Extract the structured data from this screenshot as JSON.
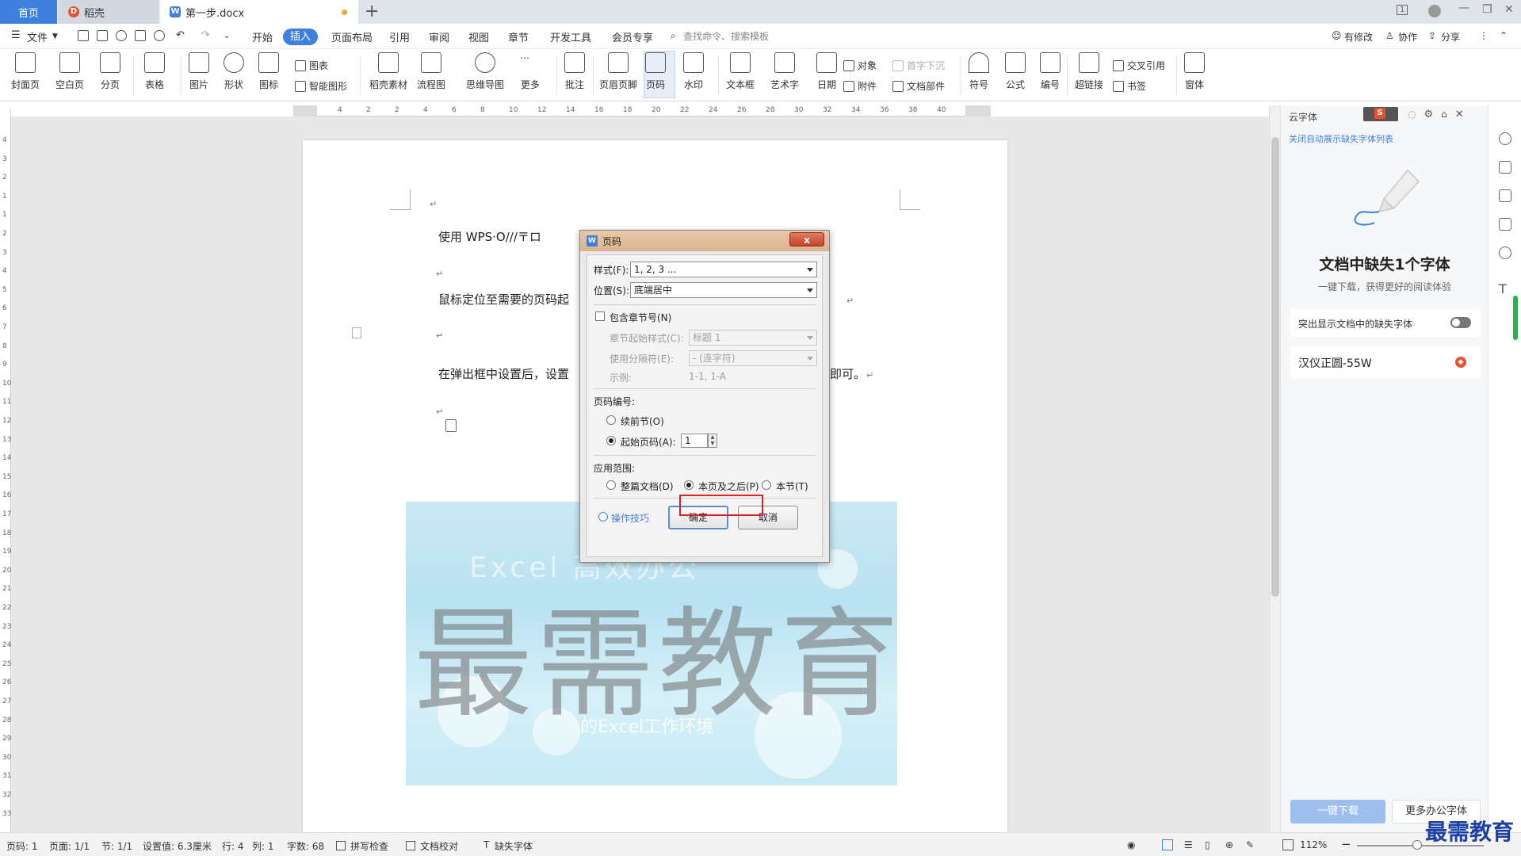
{
  "tabs": {
    "home": "首页",
    "daoke": "稻壳",
    "doc": "第一步.docx",
    "badge": "1"
  },
  "menu": {
    "file": "文件",
    "start": "开始",
    "insert": "插入",
    "layout": "页面布局",
    "reference": "引用",
    "review": "审阅",
    "view": "视图",
    "chapter": "章节",
    "devtools": "开发工具",
    "member": "会员专享",
    "search_placeholder": "查找命令、搜索模板",
    "modified": "有修改",
    "collab": "协作",
    "share": "分享"
  },
  "ribbon": {
    "cover": "封面页",
    "blank": "空白页",
    "pagebreak": "分页",
    "table": "表格",
    "picture": "图片",
    "shape": "形状",
    "icon": "图标",
    "chart": "图表",
    "smartart": "智能图形",
    "daoke_material": "稻壳素材",
    "flowchart": "流程图",
    "mindmap": "思维导图",
    "more": "更多",
    "comment": "批注",
    "header_footer": "页眉页脚",
    "page_number": "页码",
    "watermark": "水印",
    "textbox": "文本框",
    "wordart": "艺术字",
    "date": "日期",
    "object": "对象",
    "attachment": "附件",
    "dropcap": "首字下沉",
    "docparts": "文档部件",
    "symbol": "符号",
    "formula": "公式",
    "numbering": "编号",
    "hyperlink": "超链接",
    "crossref": "交叉引用",
    "bookmark": "书签",
    "window": "窗体"
  },
  "ruler": {
    "h_ticks": [
      "6",
      "4",
      "2",
      "2",
      "4",
      "6",
      "8",
      "10",
      "12",
      "14",
      "16",
      "18",
      "20",
      "22",
      "24",
      "26",
      "28",
      "30",
      "32",
      "34",
      "36",
      "38",
      "40"
    ],
    "v_ticks": [
      "4",
      "3",
      "2",
      "1",
      "1",
      "2",
      "3",
      "4",
      "5",
      "6",
      "7",
      "8",
      "9",
      "10",
      "11",
      "12",
      "13",
      "14",
      "15",
      "16",
      "17",
      "18",
      "19",
      "20",
      "21",
      "22",
      "23",
      "24",
      "25",
      "26",
      "27",
      "28",
      "29",
      "30",
      "31",
      "32",
      "33"
    ]
  },
  "document": {
    "para1": "使用 WPS·O///〒ロ",
    "para2": "鼠标定位至需要的页码起",
    "para3": "在弹出框中设置后，设置",
    "para3_tail": "即可。",
    "mark": "↵",
    "watermark": "最需教育",
    "img_text_top": "Excel 高效办公",
    "img_text": "的Excel工作环境"
  },
  "dialog": {
    "title": "页码",
    "close": "x",
    "style_label": "样式(F):",
    "style_value": "1, 2, 3 ...",
    "position_label": "位置(S):",
    "position_value": "底端居中",
    "include_chapter": "包含章节号(N)",
    "chapter_style_label": "章节起始样式(C):",
    "chapter_style_value": "标题 1",
    "separator_label": "使用分隔符(E):",
    "separator_value": "-   (连字符)",
    "example_label": "示例:",
    "example_value": "1-1, 1-A",
    "numbering_title": "页码编号:",
    "continue_label": "续前节(O)",
    "start_label": "起始页码(A):",
    "start_value": "1",
    "apply_title": "应用范围:",
    "whole_doc": "整篇文档(D)",
    "this_and_after": "本页及之后(P)",
    "this_section": "本节(T)",
    "tips": "操作技巧",
    "ok": "确定",
    "cancel": "取消"
  },
  "rightpanel": {
    "title": "云字体",
    "link": "关闭自动展示缺失字体列表",
    "heading": "文档中缺失1个字体",
    "sub": "一键下载，获得更好的阅读体验",
    "toggle_label": "突出显示文档中的缺失字体",
    "font_name": "汉仪正圆-55W",
    "download": "一键下载",
    "more": "更多办公字体"
  },
  "status": {
    "page": "页码: 1",
    "pages": "页面: 1/1",
    "section": "节: 1/1",
    "setting": "设置值: 6.3厘米",
    "row": "行: 4",
    "col": "列: 1",
    "words": "字数: 68",
    "spell": "拼写检查",
    "proof": "文档校对",
    "missing_font": "缺失字体",
    "zoom": "112%",
    "zoom_minus": "−",
    "zoom_plus": "+"
  },
  "logo": "最需教育"
}
